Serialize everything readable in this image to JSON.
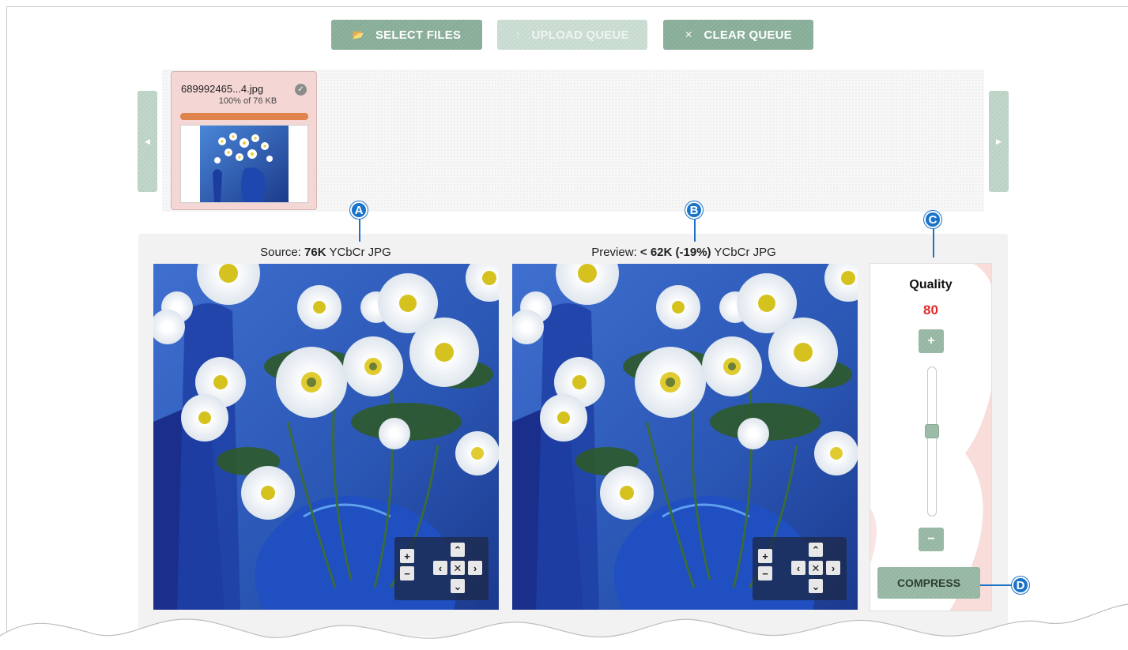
{
  "toolbar": {
    "select_label": "SELECT FILES",
    "upload_label": "UPLOAD QUEUE",
    "clear_label": "CLEAR QUEUE"
  },
  "queue": {
    "file": {
      "name": "689992465...4.jpg",
      "progress_text": "100% of 76 KB",
      "progress_percent": 100
    }
  },
  "source": {
    "prefix": "Source: ",
    "size": "76K",
    "suffix": " YCbCr JPG"
  },
  "preview": {
    "prefix": "Preview: ",
    "size": "< 62K (-19%)",
    "suffix": " YCbCr JPG"
  },
  "quality": {
    "label": "Quality",
    "value": "80",
    "level": 80,
    "compress_label": "COMPRESS"
  },
  "callouts": {
    "a": "A",
    "b": "B",
    "c": "C",
    "d": "D"
  },
  "icons": {
    "select": "folder-open-icon",
    "upload": "upload-arrow-icon",
    "clear": "close-x-icon",
    "check": "check-circle-icon"
  },
  "colors": {
    "accent_green": "#8fb39e",
    "callout_blue": "#1a73c9",
    "quality_value": "#e02a2a",
    "progress_fill": "#e0844d",
    "file_card_bg": "#f4d7d4"
  }
}
